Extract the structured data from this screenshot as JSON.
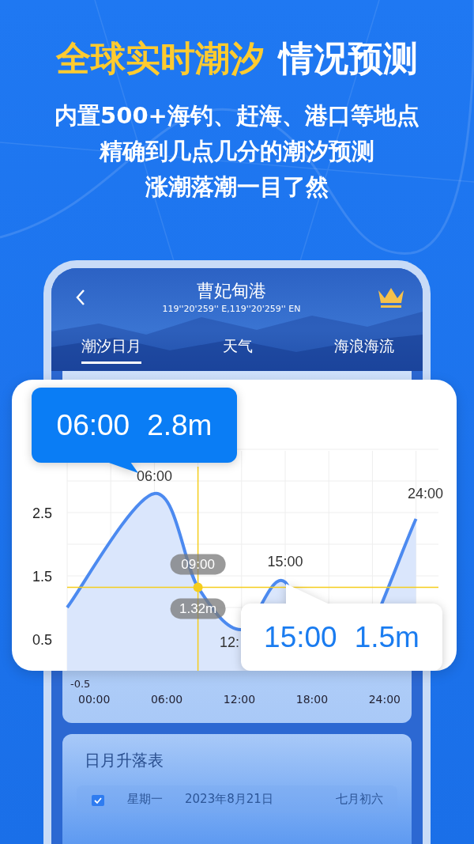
{
  "headline": {
    "highlight": "全球实时潮汐",
    "rest": "情况预测"
  },
  "subtitle_lines": [
    "内置500+海钓、赶海、港口等地点",
    "精确到几点几分的潮汐预测",
    "涨潮落潮一目了然"
  ],
  "phone": {
    "title": "曹妃甸港",
    "coordinates": "119''20'259'' E,119''20'259'' EN",
    "tabs": [
      {
        "label": "潮汐日月",
        "selected": true
      },
      {
        "label": "天气",
        "selected": false
      },
      {
        "label": "海浪海流",
        "selected": false
      }
    ],
    "axis_low_label": "-0.5",
    "time_labels": [
      "00:00",
      "06:00",
      "12:00",
      "18:00",
      "24:00"
    ],
    "sun_table": {
      "title": "日月升落表",
      "weekday": "星期一",
      "date": "2023年8月21日",
      "lunar_date": "七月初六"
    }
  },
  "tide_card": {
    "y_labels": [
      "2.5",
      "1.5",
      "0.5"
    ],
    "point_labels": [
      "06:00",
      "12:",
      "15:00",
      "24:00"
    ],
    "crosshair": {
      "time": "09:00",
      "value": "1.32m"
    },
    "tooltips": [
      {
        "kind": "dark",
        "time": "06:00",
        "value": "2.8m"
      },
      {
        "kind": "light",
        "time": "15:00",
        "value": "1.5m"
      }
    ]
  }
}
